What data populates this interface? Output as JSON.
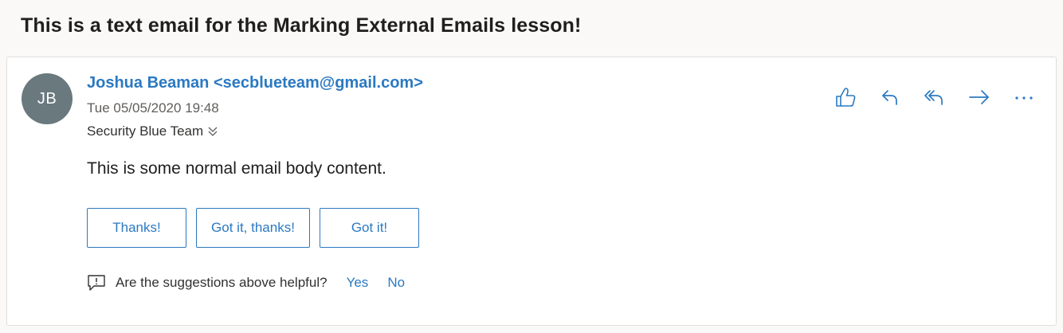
{
  "email": {
    "subject": "This is a text email for the Marking External Emails lesson!",
    "sender": "Joshua Beaman <secblueteam@gmail.com>",
    "avatar_initials": "JB",
    "date": "Tue 05/05/2020 19:48",
    "recipient": "Security Blue Team",
    "body": "This is some normal email body content."
  },
  "actions": {
    "icons": [
      "like-icon",
      "reply-icon",
      "reply-all-icon",
      "forward-icon",
      "more-actions-icon"
    ]
  },
  "suggested_replies": {
    "labels": [
      "Thanks!",
      "Got it, thanks!",
      "Got it!"
    ]
  },
  "feedback": {
    "question": "Are the suggestions above helpful?",
    "yes_label": "Yes",
    "no_label": "No"
  },
  "colors": {
    "accent": "#2b79c2",
    "avatar_bg": "#69797e",
    "page_bg": "#faf9f8"
  }
}
